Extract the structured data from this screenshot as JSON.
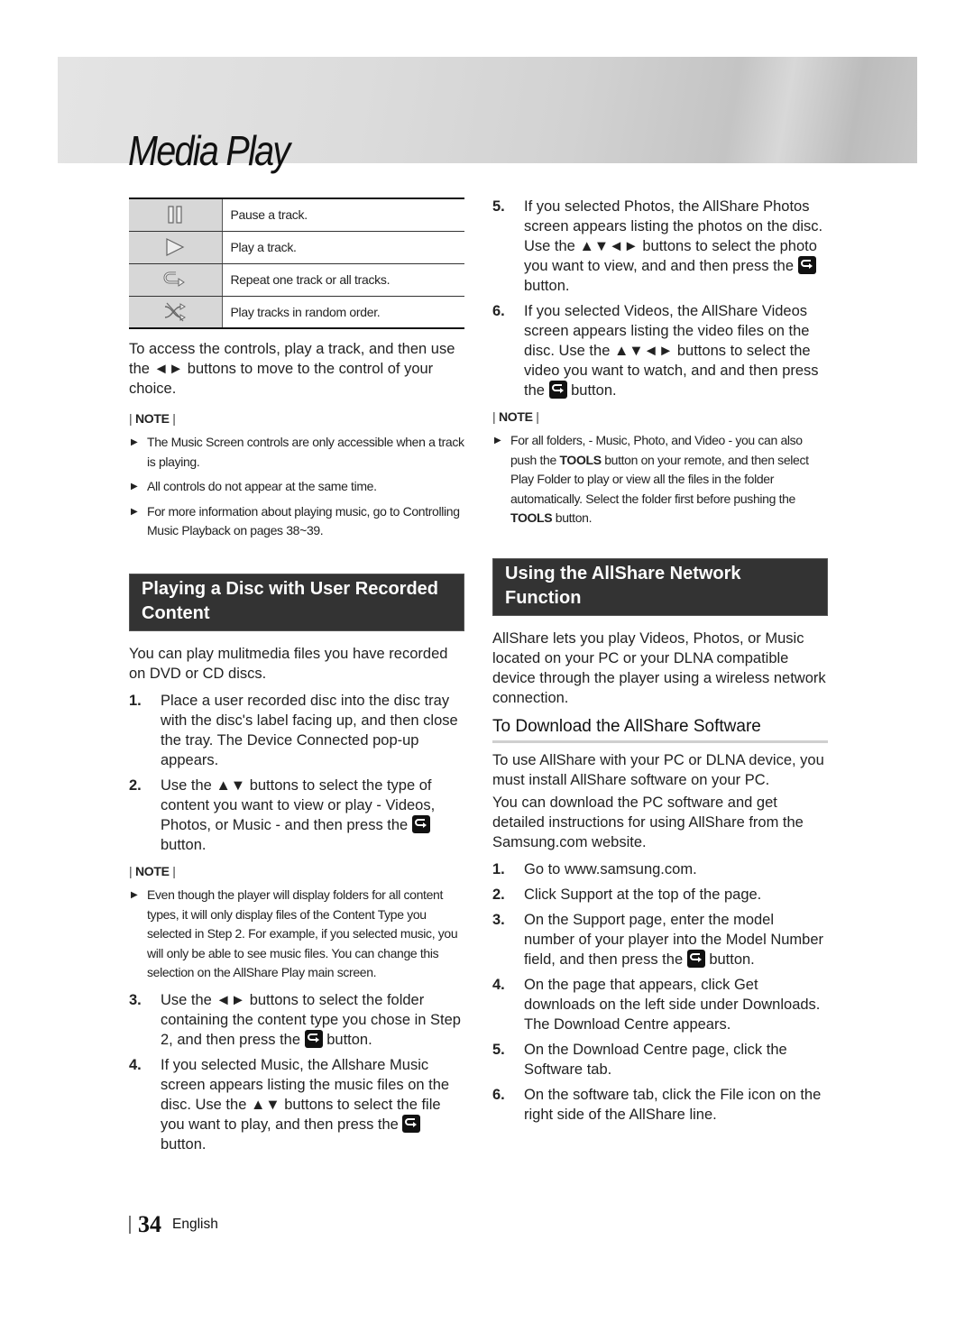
{
  "header": {
    "title": "Media Play"
  },
  "controls_table": [
    {
      "icon": "pause-icon",
      "text": "Pause a track."
    },
    {
      "icon": "play-icon",
      "text": "Play a track."
    },
    {
      "icon": "repeat-icon",
      "text": "Repeat one track or all tracks."
    },
    {
      "icon": "shuffle-icon",
      "text": "Play tracks in random order."
    }
  ],
  "left": {
    "intro": "To access the controls, play a track, and then use the ◄► buttons to move to the control of your choice.",
    "note_label": "NOTE",
    "notes1": [
      "The Music Screen controls are only accessible when a track is playing.",
      "All controls do not appear at the same time.",
      "For more information about playing music, go to Controlling Music Playback on pages 38~39."
    ],
    "section_title": "Playing a Disc with User Recorded Content",
    "section_intro": "You can play mulitmedia files you have recorded on DVD or CD discs.",
    "steps_a": [
      {
        "num": "1.",
        "text": "Place a user recorded disc into the disc tray with the disc's label facing up, and then close the tray. The Device Connected pop-up appears."
      },
      {
        "num": "2.",
        "text_before": "Use the ▲▼ buttons to select the type of content you want to view or play - Videos, Photos, or Music - and then press the",
        "text_after": "button."
      }
    ],
    "notes2": [
      "Even though the player will display folders for all content types, it will only display files of the Content Type you selected in Step 2. For example, if you selected music, you will only be able to see music files. You can change this selection on the AllShare Play main screen."
    ],
    "steps_b": [
      {
        "num": "3.",
        "text_before": "Use the ◄► buttons to select the folder containing the content type you chose in Step 2, and then press the",
        "text_after": "button."
      },
      {
        "num": "4.",
        "text_before": "If you selected Music, the Allshare Music screen appears listing the music files on the disc. Use the ▲▼ buttons to select the file you want to play, and then press the",
        "text_after": "button."
      }
    ]
  },
  "right": {
    "steps_c": [
      {
        "num": "5.",
        "text_before": "If you selected Photos, the AllShare Photos screen appears listing the photos on the disc. Use the ▲▼◄► buttons to select the photo you want to view, and and then press the",
        "text_after": "button."
      },
      {
        "num": "6.",
        "text_before": "If you selected Videos, the AllShare Videos screen appears listing the video files on the disc. Use the ▲▼◄► buttons to select the video you want to watch, and and then press the",
        "text_after": "button."
      }
    ],
    "note_label": "NOTE",
    "note3": {
      "part1": "For all folders, - Music, Photo, and Video - you can also push the",
      "tools1": "TOOLS",
      "part2": "button on your remote, and then select Play Folder to play or view all the files in the folder automatically. Select the folder first before pushing the",
      "tools2": "TOOLS",
      "part3": "button."
    },
    "section_title": "Using the AllShare Network Function",
    "section_intro": "AllShare lets you play Videos, Photos, or Music located on your PC or your DLNA compatible device through the player using a wireless network connection.",
    "sub_title": "To Download the AllShare Software",
    "sub_p1": "To use AllShare with your PC or DLNA device, you must install AllShare software on your PC.",
    "sub_p2": "You can download the PC software and get detailed instructions for using AllShare from the Samsung.com website.",
    "steps_d": [
      {
        "num": "1.",
        "text": "Go to www.samsung.com."
      },
      {
        "num": "2.",
        "text": "Click Support at the top of the page."
      },
      {
        "num": "3.",
        "text_before": "On the Support page, enter the model number of your player into the Model Number field, and then press the",
        "text_after": "button."
      },
      {
        "num": "4.",
        "text": "On the page that appears, click Get downloads on the left side under Downloads. The Download Centre appears."
      },
      {
        "num": "5.",
        "text": "On the Download Centre page, click the Software tab."
      },
      {
        "num": "6.",
        "text": "On the software tab, click the File icon on the right side of the AllShare line."
      }
    ]
  },
  "footer": {
    "page_number": "34",
    "language": "English"
  }
}
